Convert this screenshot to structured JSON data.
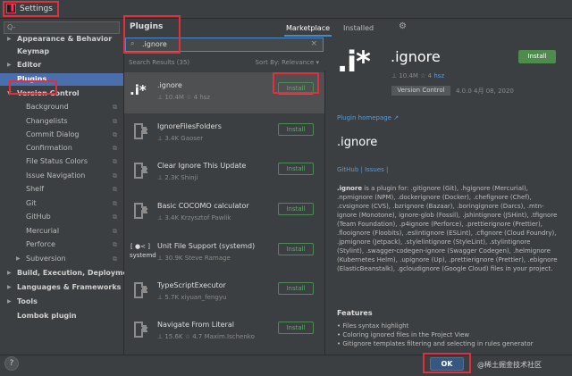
{
  "window": {
    "title": "Settings",
    "icon": "intellij-app-icon"
  },
  "sidebar": {
    "search_placeholder": "Q-",
    "items": [
      {
        "label": "Appearance & Behavior",
        "bold": true,
        "arrow": "right"
      },
      {
        "label": "Keymap",
        "bold": true
      },
      {
        "label": "Editor",
        "bold": true,
        "arrow": "right"
      },
      {
        "label": "Plugins",
        "bold": true,
        "selected": true
      },
      {
        "label": "Version Control",
        "bold": true,
        "arrow": "down"
      },
      {
        "label": "Background"
      },
      {
        "label": "Changelists"
      },
      {
        "label": "Commit Dialog"
      },
      {
        "label": "Confirmation"
      },
      {
        "label": "File Status Colors"
      },
      {
        "label": "Issue Navigation"
      },
      {
        "label": "Shelf"
      },
      {
        "label": "Git"
      },
      {
        "label": "GitHub"
      },
      {
        "label": "Mercurial"
      },
      {
        "label": "Perforce"
      },
      {
        "label": "Subversion",
        "arrow": "right"
      },
      {
        "label": "Build, Execution, Deployment",
        "bold": true,
        "arrow": "right"
      },
      {
        "label": "Languages & Frameworks",
        "bold": true,
        "arrow": "right"
      },
      {
        "label": "Tools",
        "bold": true,
        "arrow": "right"
      },
      {
        "label": "Lombok plugin",
        "bold": true
      }
    ]
  },
  "header": {
    "title": "Plugins",
    "tabs": [
      {
        "label": "Marketplace",
        "active": true
      },
      {
        "label": "Installed",
        "active": false
      }
    ],
    "settings_icon": "gear-icon"
  },
  "search": {
    "value": ".ignore",
    "clear_icon": "close-icon"
  },
  "results": {
    "count_label": "Search Results (35)",
    "sort_label": "Sort By: Relevance ▾"
  },
  "plugins": [
    {
      "name": ".ignore",
      "meta": "⊥ 10.4M  ☆ 4  hsz",
      "button": "Install",
      "selected": true,
      "icon": "ignore-logo"
    },
    {
      "name": "IgnoreFilesFolders",
      "meta": "⊥ 3.4K  Gaoser",
      "button": "Install",
      "icon": "plugin-plug-icon"
    },
    {
      "name": "Clear Ignore This Update",
      "meta": "⊥ 2.3K  Shinji",
      "button": "Install",
      "icon": "plugin-plug-icon"
    },
    {
      "name": "Basic COCOMO calculator",
      "meta": "⊥ 3.4K  Krzysztof Pawlik",
      "button": "Install",
      "icon": "plugin-plug-icon"
    },
    {
      "name": "Unit File Support (systemd)",
      "meta": "⊥ 30.9K  Steve Ramage",
      "button": "Install",
      "icon": "systemd-logo"
    },
    {
      "name": "TypeScriptExecutor",
      "meta": "⊥ 5.7K  xiyuan_fengyu",
      "button": "Install",
      "icon": "plugin-plug-icon"
    },
    {
      "name": "Navigate From Literal",
      "meta": "⊥ 15.6K  ☆ 4.7  Maxim.Ischenko",
      "button": "Install",
      "icon": "plugin-plug-icon"
    }
  ],
  "detail": {
    "logo_text": ".i*",
    "name": ".ignore",
    "meta_downloads": "⊥ 10.4M  ☆ 4",
    "meta_vendor": "hsz",
    "category": "Version Control",
    "version": "4.0.0  4月 08, 2020",
    "install_label": "Install",
    "homepage": "Plugin homepage ↗",
    "title": ".ignore",
    "links": "GitHub | Issues |",
    "desc_bold": ".ignore",
    "description": " is a plugin for: .gitignore (Git), .hgignore (Mercurial), .npmignore (NPM), .dockerignore (Docker), .chefignore (Chef), .cvsignore (CVS), .bzrignore (Bazaar), .boringignore (Darcs), .mtn-ignore (Monotone), ignore-glob (Fossil), .jshintignore (JSHint), .tfignore (Team Foundation), .p4ignore (Perforce), .prettierignore (Prettier), .flooignore (Floobits), .eslintignore (ESLint), .cfignore (Cloud Foundry), .jpmignore (Jetpack), .stylelintignore (StyleLint), .stylintignore (Stylint), .swagger-codegen-ignore (Swagger Codegen), .helmignore (Kubernetes Helm), .upignore (Up), .prettierignore (Prettier), .ebignore (ElasticBeanstalk), .gcloudignore (Google Cloud) files in your project.",
    "features_title": "Features",
    "features": [
      "Files syntax highlight",
      "Coloring ignored files in the Project View",
      "Gitignore templates filtering and selecting in rules generator"
    ]
  },
  "footer": {
    "help": "?",
    "ok": "OK",
    "watermark": "@稀土掘金技术社区"
  }
}
